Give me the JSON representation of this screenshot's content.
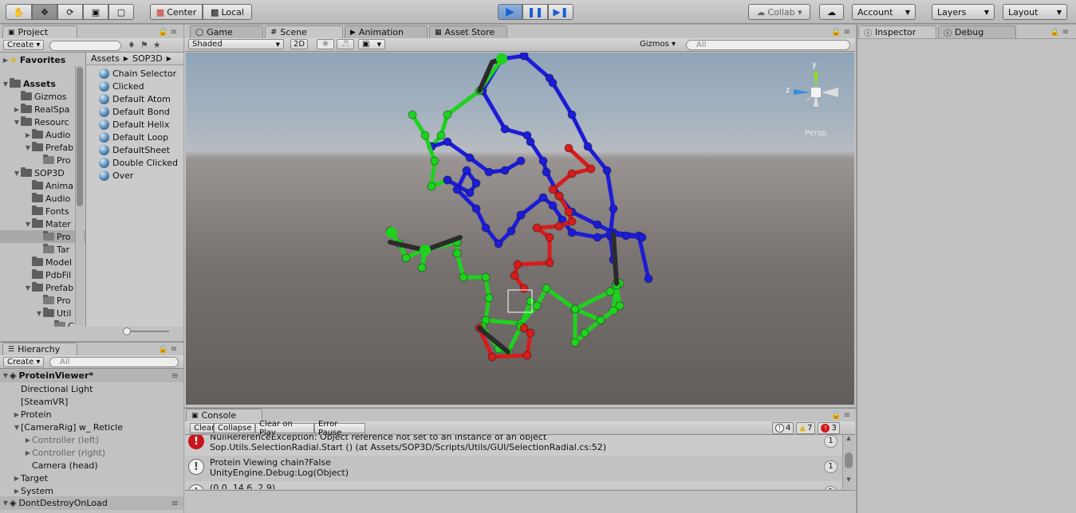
{
  "toolbar": {
    "pivot": "Center",
    "space": "Local",
    "collab": "Collab ▾",
    "account": "Account",
    "layers": "Layers",
    "layout": "Layout"
  },
  "project": {
    "tab": "Project",
    "create": "Create ▾",
    "favorites": "Favorites",
    "assets": "Assets",
    "tree": [
      "Gizmos",
      "RealSpa",
      "Resourc",
      "Audio",
      "Prefab",
      "Pro",
      "SOP3D",
      "Anima",
      "Audio",
      "Fonts",
      "Mater",
      "Pro",
      "Tar",
      "Model",
      "PdbFil",
      "Prefab",
      "Pro",
      "Util",
      "C"
    ],
    "breadcrumb": [
      "Assets",
      "SOP3D"
    ],
    "files": [
      "Chain Selector",
      "Clicked",
      "Default Atom",
      "Default Bond",
      "Default Helix",
      "Default Loop",
      "DefaultSheet",
      "Double Clicked",
      "Over"
    ]
  },
  "hierarchy": {
    "tab": "Hierarchy",
    "create": "Create ▾",
    "search": "All",
    "scene": "ProteinViewer*",
    "items": [
      "Directional Light",
      "[SteamVR]",
      "Protein",
      "[CameraRig] w_ Reticle",
      "Controller (left)",
      "Controller (right)",
      "Camera (head)",
      "Target",
      "System"
    ],
    "dont_destroy": "DontDestroyOnLoad"
  },
  "tabs": {
    "game": "Game",
    "scene": "Scene",
    "animation": "Animation",
    "asset_store": "Asset Store",
    "inspector": "Inspector",
    "debug": "Debug"
  },
  "scene_bar": {
    "shading": "Shaded",
    "mode2d": "2D",
    "gizmos": "Gizmos ▾",
    "search": "All"
  },
  "gizmo": {
    "y": "y",
    "z": "z",
    "persp": "Persp"
  },
  "console": {
    "tab": "Console",
    "buttons": [
      "Clear",
      "Collapse",
      "Clear on Play",
      "Error Pause"
    ],
    "counts": {
      "info": "4",
      "warn": "7",
      "error": "3"
    },
    "entries": [
      {
        "line1": "NullReferenceException: Object reference not set to an instance of an object",
        "line2": "Sop.Utils.SelectionRadial.Start () (at Assets/SOP3D/Scripts/Utils/GUI/SelectionRadial.cs:52)",
        "count": "1",
        "type": "error"
      },
      {
        "line1": "Protein Viewing chain?False",
        "line2": "UnityEngine.Debug:Log(Object)",
        "count": "1",
        "type": "info"
      },
      {
        "line1": "(0.0, 14.6, 2.9)",
        "line2": "",
        "count": "1",
        "type": "info"
      }
    ]
  },
  "colors": {
    "blue": "#1c1cd6",
    "green": "#1ed21e",
    "red": "#d61c1c",
    "dark": "#2b2b2b",
    "accent": "#3c78c8"
  }
}
